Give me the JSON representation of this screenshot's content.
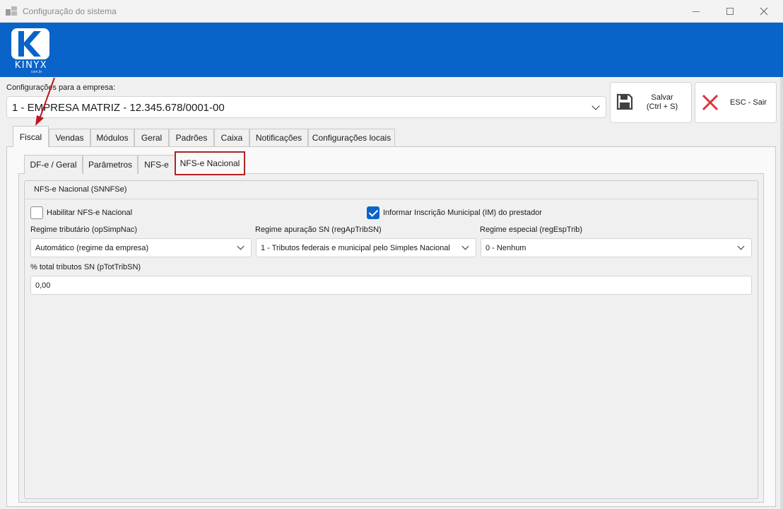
{
  "window": {
    "title": "Configuração do sistema"
  },
  "logo": {
    "brand": "KINYX",
    "domain": "com.br",
    "icon": "kinyx-logo"
  },
  "company": {
    "label": "Configurações para a empresa:",
    "selected": "1 - EMPRESA MATRIZ - 12.345.678/0001-00"
  },
  "actions": {
    "save_label_line1": "Salvar",
    "save_label_line2": "(Ctrl + S)",
    "save_icon": "floppy-disk-icon",
    "exit_label": "ESC - Sair",
    "exit_icon": "close-x-icon",
    "exit_icon_color": "#e0303a"
  },
  "main_tabs": [
    {
      "label": "Fiscal",
      "active": true
    },
    {
      "label": "Vendas"
    },
    {
      "label": "Módulos"
    },
    {
      "label": "Geral"
    },
    {
      "label": "Padrões"
    },
    {
      "label": "Caixa"
    },
    {
      "label": "Notificações"
    },
    {
      "label": "Configurações locais"
    }
  ],
  "sub_tabs": [
    {
      "label": "DF-e / Geral"
    },
    {
      "label": "Parâmetros"
    },
    {
      "label": "NFS-e"
    },
    {
      "label": "NFS-e Nacional",
      "active": true
    }
  ],
  "group": {
    "title": "NFS-e Nacional (SNNFSe)",
    "habilitar": {
      "label": "Habilitar NFS-e Nacional",
      "checked": false
    },
    "informar_im": {
      "label": "Informar Inscrição Municipal (IM) do prestador",
      "checked": true
    },
    "regime_tributario": {
      "label": "Regime tributário (opSimpNac)",
      "value": "Automático (regime da empresa)"
    },
    "regime_apuracao": {
      "label": "Regime apuração SN (regApTribSN)",
      "value": "1 - Tributos federais e municipal pelo Simples Nacional"
    },
    "regime_especial": {
      "label": "Regime especial (regEspTrib)",
      "value": "0 - Nenhum"
    },
    "total_tributos": {
      "label": "% total tributos SN (pTotTribSN)",
      "value": "0,00"
    }
  },
  "colors": {
    "header_blue": "#0a63c9",
    "highlight_red": "#b22222",
    "annotation_arrow": "#c0141e"
  }
}
